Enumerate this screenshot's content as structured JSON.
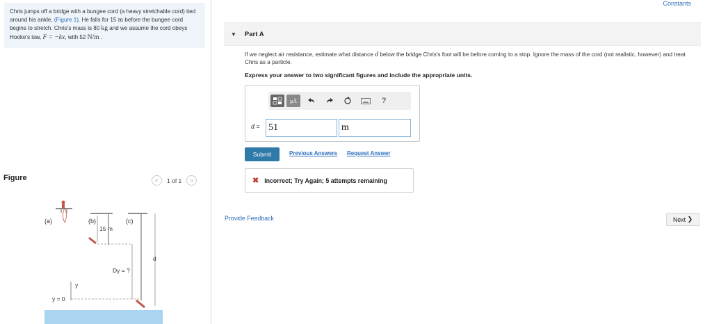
{
  "problem": {
    "text_1": "Chris jumps off a bridge with a bungee cord (a heavy stretchable cord) tied around his ankle, ",
    "figure_link": "(Figure 1)",
    "text_2": ". He falls for 15 ",
    "unit_m": "m",
    "text_3": " before the bungee cord begins to stretch. Chris's mass is 80 ",
    "unit_kg": "kg",
    "text_4": " and we assume the cord obeys Hooke's law, ",
    "formula": "F = −kx",
    "text_5": ", with 52 ",
    "unit_nm": "N/m",
    "text_6": " ."
  },
  "figure": {
    "heading": "Figure",
    "pager_text": "1 of 1",
    "prev_arrow": "<",
    "next_arrow": ">",
    "label_a": "(a)",
    "label_b": "(b)",
    "label_c": "(c)",
    "label_15m": "15 m",
    "label_d": "d",
    "label_dy": "Dy = ?",
    "label_y": "y",
    "label_y0": "y = 0"
  },
  "header": {
    "constants_link": "Constants"
  },
  "part": {
    "title": "Part A",
    "caret": "▼"
  },
  "question": {
    "text_1": "If we neglect air resistance, estimate what distance ",
    "var_d": "d",
    "text_2": " below the bridge Chris's foot will be before coming to a stop. Ignore the mass of the cord (not realistic, however) and treat Chris as a particle.",
    "instruction": "Express your answer to two significant figures and include the appropriate units."
  },
  "answer": {
    "toolbar_mu": "μÅ",
    "help": "?",
    "label_var": "d",
    "label_eq": " = ",
    "value": "51",
    "unit": "m"
  },
  "actions": {
    "submit": "Submit",
    "previous_answers": "Previous Answers",
    "request_answer": "Request Answer"
  },
  "feedback": {
    "icon": "✖",
    "message": "Incorrect; Try Again; 5 attempts remaining"
  },
  "footer": {
    "provide_feedback": "Provide Feedback",
    "next": "Next",
    "next_chevron": "❯"
  },
  "colors": {
    "link": "#2a6ebb",
    "submit_bg": "#2f7aa8",
    "error": "#c0392b",
    "problem_bg": "#eef4fa",
    "water": "#a9d5f0"
  }
}
